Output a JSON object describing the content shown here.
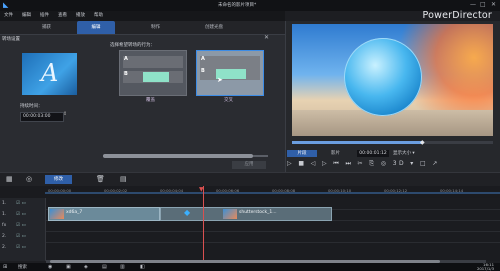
{
  "window": {
    "title": "未命名的影片项目*",
    "brand": "PowerDirector",
    "menu": [
      "文件",
      "编辑",
      "插件",
      "查看",
      "播放",
      "帮助"
    ],
    "controls": [
      "—",
      "□",
      "✕"
    ]
  },
  "tabs": [
    "捕获",
    "编辑",
    "制作",
    "创建光盘"
  ],
  "panel": {
    "header": "转场设置",
    "close": "✕",
    "duration_label": "持续时间：",
    "duration_value": "00:00:03:00",
    "options_label": "选择希望转场的行为：",
    "option1_caption": "覆盖",
    "option2_caption": "交叉",
    "apply": "应用",
    "letter_a": "A",
    "letter_b": "B"
  },
  "preview": {
    "tab_clip": "片段",
    "tab_movie": "影片",
    "timecode": "00:00:01:12",
    "fit": "显示大小 ▾",
    "controls": "▷ ■ ◁ ▷ ⏮ ⏭ ✂ ⎘ ◎ 3D ▾ □ ↗"
  },
  "timeline": {
    "edit_button": "修改",
    "ruler": [
      "00;00;00;00",
      "00;00;02;02",
      "00;00;04;04",
      "00;00;06;06",
      "00;00;08;08",
      "00;00;10;10",
      "00;00;12;12",
      "00;00;14;14"
    ],
    "tracks": [
      "1.",
      "1.",
      "fx",
      "2.",
      "2."
    ],
    "clip1_label": "xd6a_7",
    "clip2_label": "shutterstock_1..."
  },
  "taskbar": {
    "start": "⊞",
    "search": "搜索",
    "time": "16:11",
    "date": "2017/1/3"
  },
  "colors": {
    "accent": "#2f5fa8",
    "selected_border": "#3c8ce6",
    "playhead": "#d95050"
  }
}
